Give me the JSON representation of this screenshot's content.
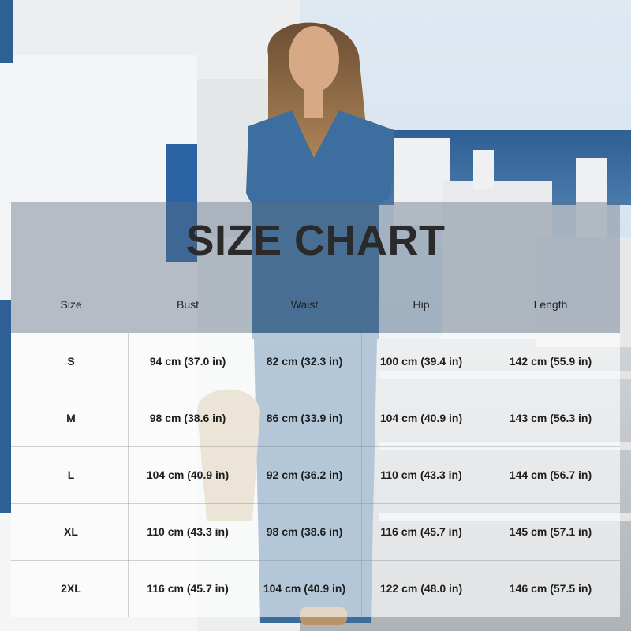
{
  "title": "SIZE CHART",
  "headers": [
    "Size",
    "Bust",
    "Waist",
    "Hip",
    "Length"
  ],
  "rows": [
    {
      "size": "S",
      "bust": "94 cm (37.0 in)",
      "waist": "82 cm (32.3 in)",
      "hip": "100 cm (39.4 in)",
      "length": "142 cm (55.9 in)"
    },
    {
      "size": "M",
      "bust": "98 cm (38.6 in)",
      "waist": "86 cm (33.9 in)",
      "hip": "104 cm (40.9 in)",
      "length": "143 cm (56.3 in)"
    },
    {
      "size": "L",
      "bust": "104 cm (40.9 in)",
      "waist": "92 cm (36.2 in)",
      "hip": "110 cm (43.3 in)",
      "length": "144 cm (56.7 in)"
    },
    {
      "size": "XL",
      "bust": "110 cm (43.3 in)",
      "waist": "98 cm (38.6 in)",
      "hip": "116 cm (45.7 in)",
      "length": "145 cm (57.1 in)"
    },
    {
      "size": "2XL",
      "bust": "116 cm (45.7 in)",
      "waist": "104 cm (40.9 in)",
      "hip": "122 cm (48.0 in)",
      "length": "146 cm (57.5 in)"
    }
  ]
}
